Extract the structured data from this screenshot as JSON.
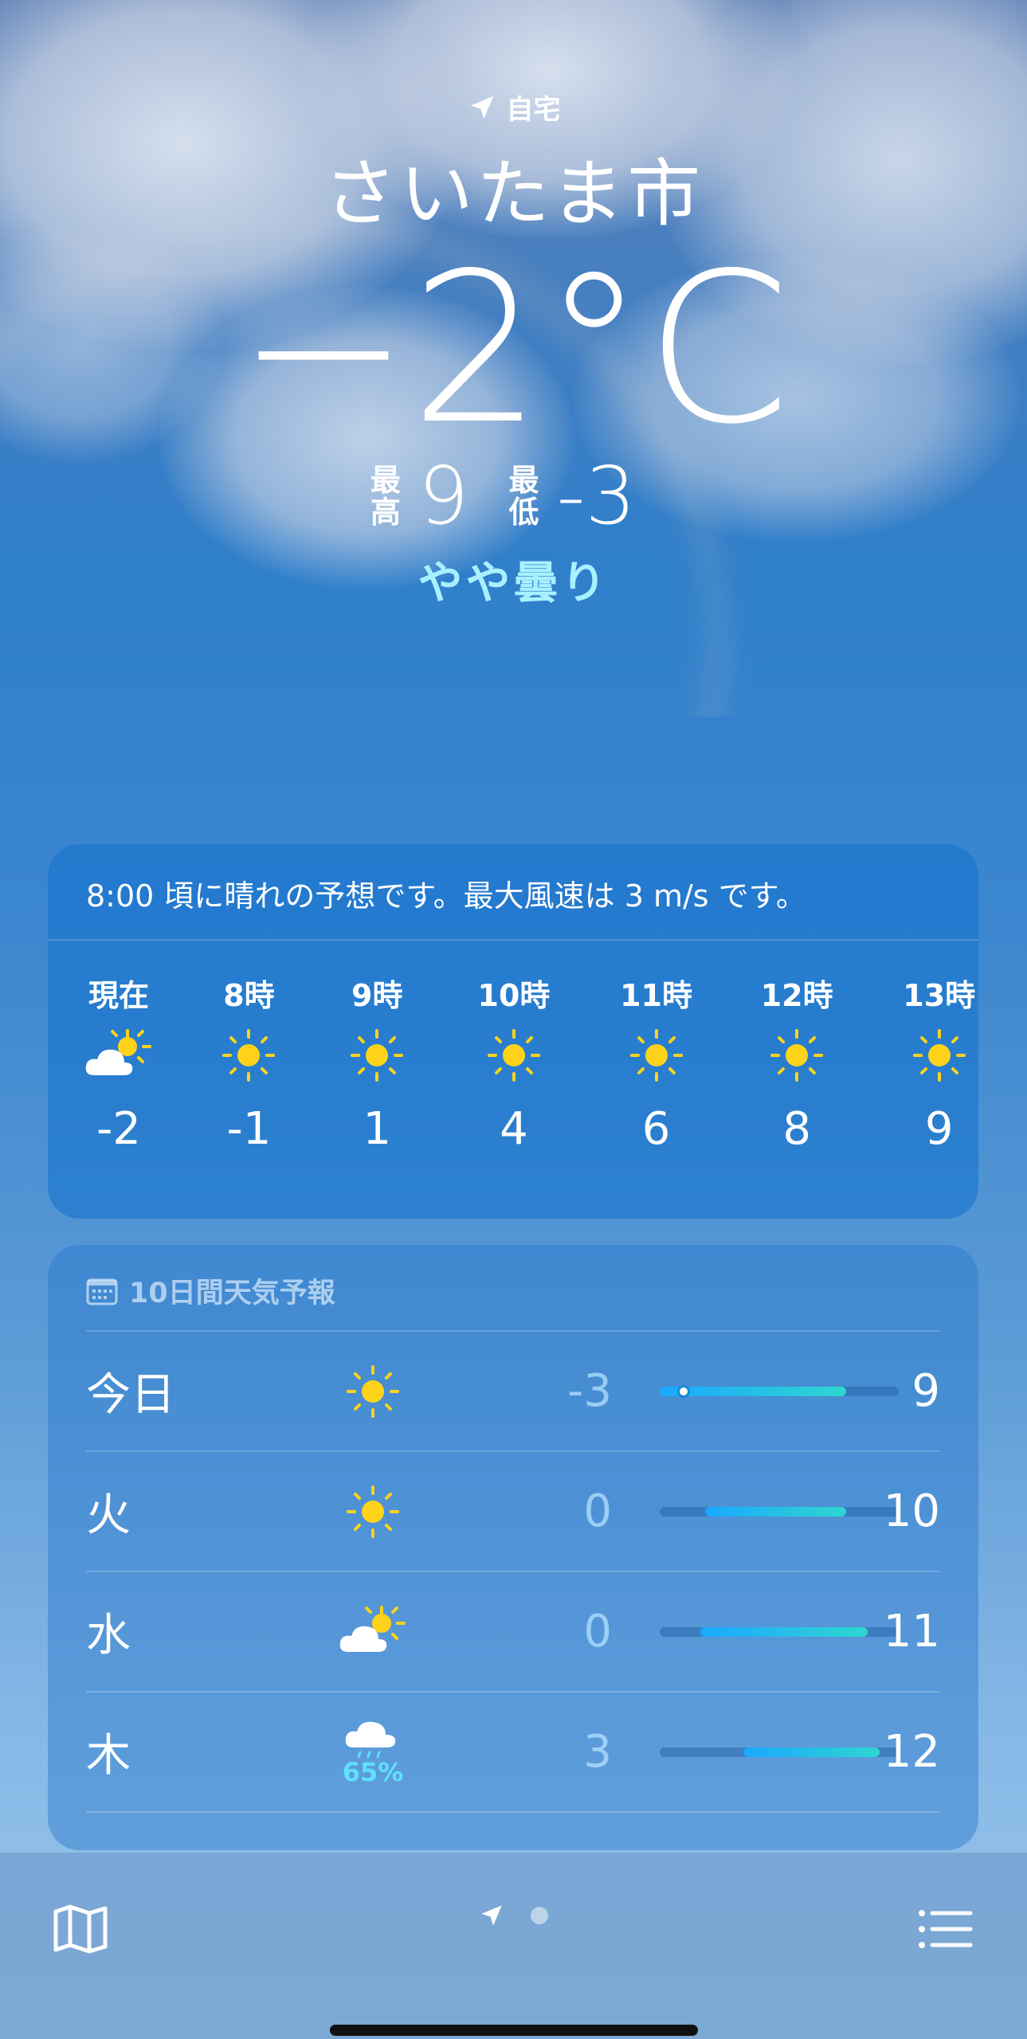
{
  "header": {
    "location_label": "自宅",
    "city": "さいたま市",
    "temperature": "−2°C",
    "high_label": [
      "最",
      "高"
    ],
    "high": "9",
    "low_label": [
      "最",
      "低"
    ],
    "low": "-3",
    "condition": "やや曇り"
  },
  "hourly": {
    "summary": "8:00 頃に晴れの予想です。最大風速は 3 m/s です。",
    "items": [
      {
        "label": "現在",
        "icon": "partly-cloudy-icon",
        "temp": "-2"
      },
      {
        "label": "8時",
        "icon": "sun-icon",
        "temp": "-1"
      },
      {
        "label": "9時",
        "icon": "sun-icon",
        "temp": "1"
      },
      {
        "label": "10時",
        "icon": "sun-icon",
        "temp": "4"
      },
      {
        "label": "11時",
        "icon": "sun-icon",
        "temp": "6"
      },
      {
        "label": "12時",
        "icon": "sun-icon",
        "temp": "8"
      },
      {
        "label": "13時",
        "icon": "sun-icon",
        "temp": "9"
      }
    ]
  },
  "forecast": {
    "title": "10日間天気予報",
    "days": [
      {
        "day": "今日",
        "icon": "sun-icon",
        "pop": "",
        "low": "-3",
        "high": "9",
        "range_start": 0.0,
        "range_end": 0.78,
        "current": 0.1
      },
      {
        "day": "火",
        "icon": "sun-icon",
        "pop": "",
        "low": "0",
        "high": "10",
        "range_start": 0.19,
        "range_end": 0.78
      },
      {
        "day": "水",
        "icon": "partly-cloudy-icon",
        "pop": "",
        "low": "0",
        "high": "11",
        "range_start": 0.17,
        "range_end": 0.87
      },
      {
        "day": "木",
        "icon": "rain-cloud-icon",
        "pop": "65%",
        "low": "3",
        "high": "12",
        "range_start": 0.35,
        "range_end": 0.92
      }
    ]
  },
  "colors": {
    "condition": "#a8f0ff",
    "bar_cold": "#1aa8ff",
    "bar_warm": "#2fd6d0",
    "sun": "#ffd31a"
  }
}
